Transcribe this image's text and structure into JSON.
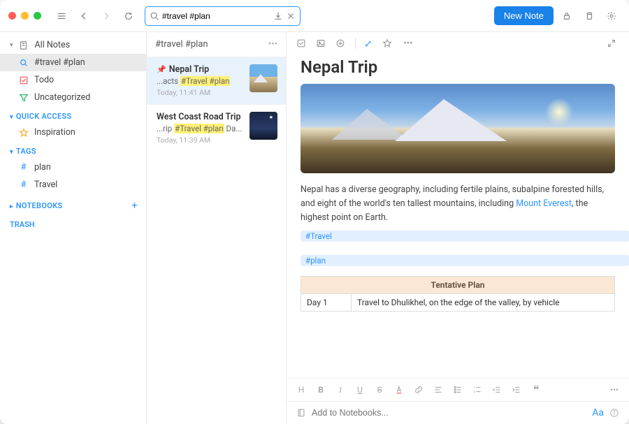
{
  "titlebar": {
    "search_value": "#travel #plan",
    "new_note_label": "New Note"
  },
  "sidebar": {
    "allnotes_label": "All Notes",
    "search_item_label": "#travel #plan",
    "todo_label": "Todo",
    "uncategorized_label": "Uncategorized",
    "quickaccess_label": "QUICK ACCESS",
    "inspiration_label": "Inspiration",
    "tags_label": "TAGS",
    "tag_items": [
      {
        "label": "plan"
      },
      {
        "label": "Travel"
      }
    ],
    "notebooks_label": "NOTEBOOKS",
    "trash_label": "TRASH"
  },
  "notelist": {
    "header": "#travel #plan",
    "items": [
      {
        "title": "Nepal Trip",
        "pinned": true,
        "excerpt_pre": "...acts ",
        "excerpt_hl": "#Travel #plan",
        "excerpt_post": "",
        "date": "Today, 11:41 AM",
        "thumb": "mtn"
      },
      {
        "title": "West Coast Road Trip",
        "pinned": false,
        "excerpt_pre": "...rip ",
        "excerpt_hl": "#Travel #plan",
        "excerpt_post": " Da...",
        "date": "Today, 11:39 AM",
        "thumb": "night"
      }
    ]
  },
  "editor": {
    "title": "Nepal Trip",
    "body_pre": "Nepal has a diverse geography, including fertile plains, subalpine forested hills, and eight of the world's ten tallest mountains, including ",
    "body_link": "Mount Everest",
    "body_post": ", the highest point on Earth.",
    "tag1": "#Travel",
    "tag2": "#plan",
    "table_caption": "Tentative Plan",
    "table_row_day": "Day 1",
    "table_row_text": "Travel to Dhulikhel, on the edge of the valley, by vehicle",
    "add_notebooks_placeholder": "Add to Notebooks..."
  },
  "format": {
    "h": "H",
    "b": "B",
    "i": "I",
    "u": "U",
    "s": "S",
    "aa": "Aa"
  }
}
